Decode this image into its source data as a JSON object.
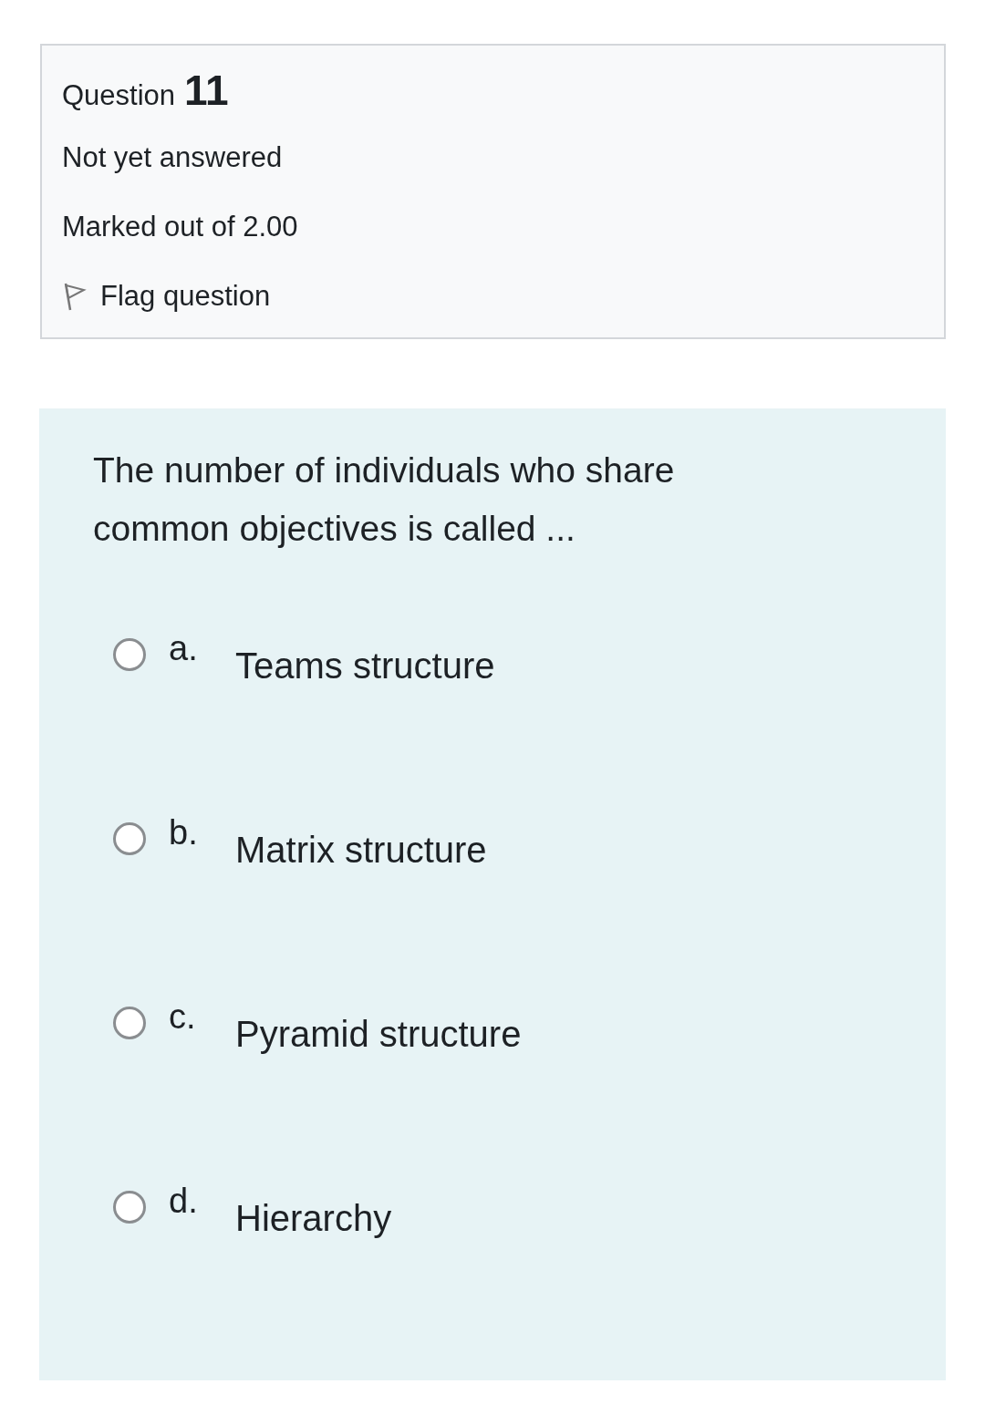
{
  "info": {
    "question_label": "Question",
    "question_number": "11",
    "status": "Not yet answered",
    "marks": "Marked out of 2.00",
    "flag": {
      "label": "Flag question",
      "flagged": false
    }
  },
  "question": {
    "text": "The number of individuals who share common objectives is called ...",
    "options": [
      {
        "letter": "a.",
        "label": "Teams structure",
        "selected": false
      },
      {
        "letter": "b.",
        "label": "Matrix structure",
        "selected": false
      },
      {
        "letter": "c.",
        "label": "Pyramid structure",
        "selected": false
      },
      {
        "letter": "d.",
        "label": "Hierarchy",
        "selected": false
      }
    ]
  }
}
